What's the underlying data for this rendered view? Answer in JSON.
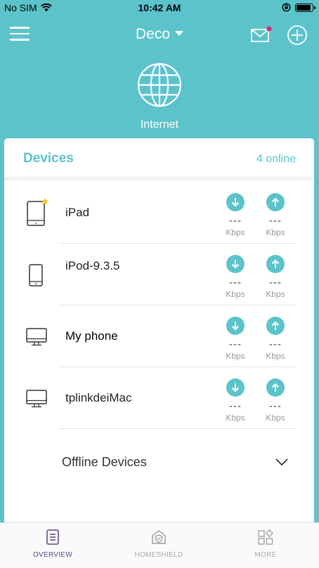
{
  "status_bar": {
    "carrier": "No SIM",
    "time": "10:42 AM"
  },
  "nav": {
    "title": "Deco"
  },
  "internet": {
    "label": "Internet"
  },
  "devices": {
    "title": "Devices",
    "online_count": "4 online",
    "items": [
      {
        "name": "iPad",
        "icon": "tablet-icon",
        "favorite": true,
        "down": "---",
        "up": "---",
        "down_unit": "Kbps",
        "up_unit": "Kbps"
      },
      {
        "name": "iPod-9.3.5",
        "icon": "phone-icon",
        "favorite": false,
        "down": "---",
        "up": "---",
        "down_unit": "Kbps",
        "up_unit": "Kbps"
      },
      {
        "name": "My phone",
        "icon": "desktop-icon",
        "favorite": false,
        "down": "---",
        "up": "---",
        "down_unit": "Kbps",
        "up_unit": "Kbps"
      },
      {
        "name": "tplinkdeiMac",
        "icon": "desktop-icon",
        "favorite": false,
        "down": "---",
        "up": "---",
        "down_unit": "Kbps",
        "up_unit": "Kbps"
      }
    ],
    "offline_label": "Offline Devices"
  },
  "tabs": [
    {
      "label": "OVERVIEW",
      "icon": "overview-icon",
      "active": true
    },
    {
      "label": "HOMESHIELD",
      "icon": "homeshield-icon",
      "active": false
    },
    {
      "label": "MORE",
      "icon": "more-icon",
      "active": false
    }
  ],
  "colors": {
    "accent": "#5cc3cb",
    "active_tab": "#5b3f8c",
    "notification_dot": "#c0307a",
    "favorite_star": "#f5c518"
  }
}
